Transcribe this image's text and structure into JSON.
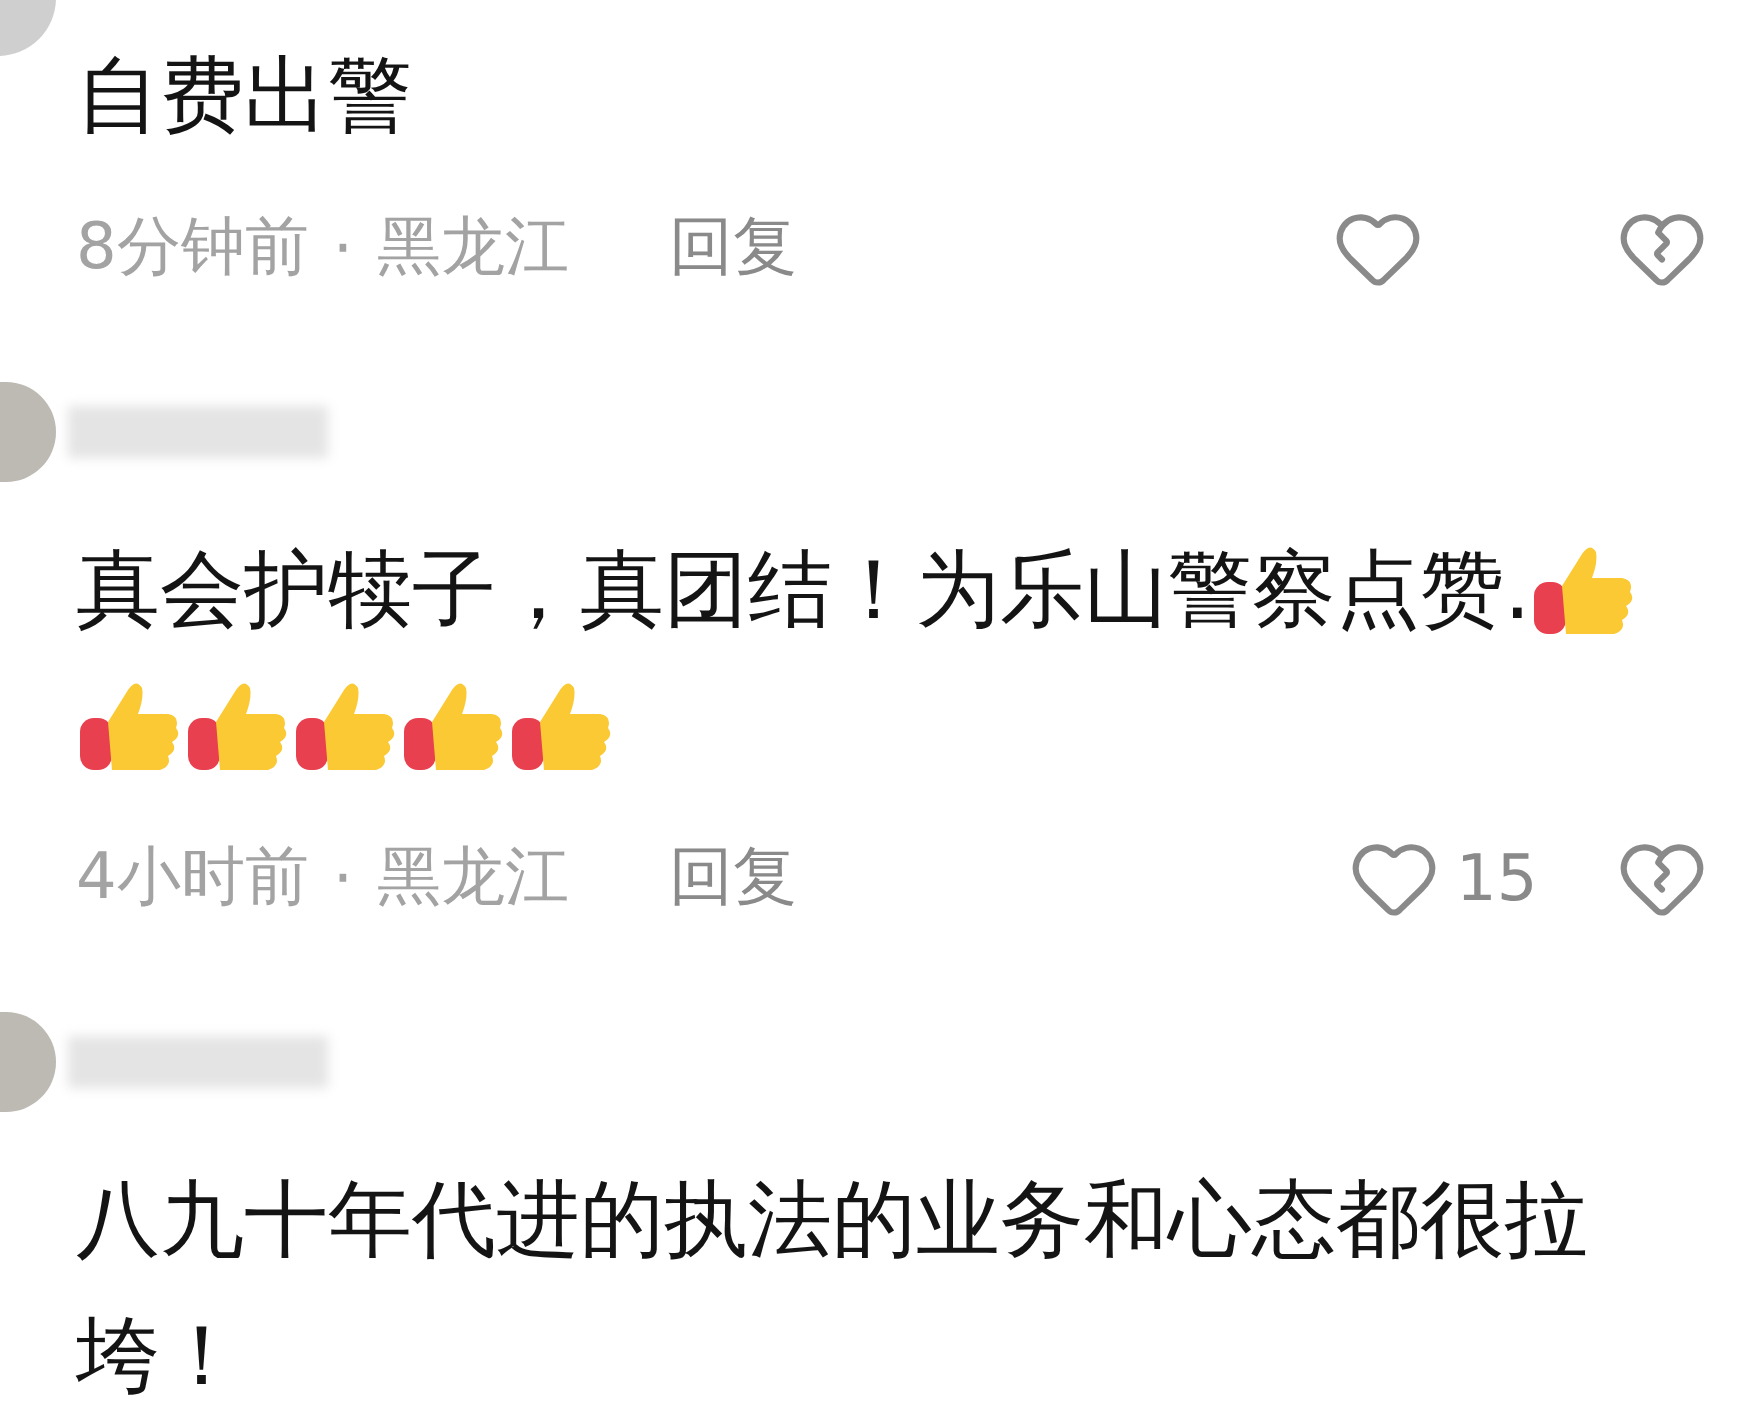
{
  "comments": [
    {
      "kind": "cut",
      "text": "自费出警",
      "meta": {
        "time": "8分钟前",
        "separator": "·",
        "location": "黑龙江",
        "reply": "回复"
      }
    },
    {
      "kind": "full",
      "text": "真会护犊子，真团结！为乐山警察点赞.",
      "reactions": [
        {
          "kind": "thumbs-up"
        },
        {
          "kind": "thumbs-up"
        },
        {
          "kind": "thumbs-up"
        },
        {
          "kind": "thumbs-up"
        },
        {
          "kind": "thumbs-up"
        },
        {
          "kind": "thumbs-up"
        }
      ],
      "meta": {
        "time": "4小时前",
        "separator": "·",
        "location": "黑龙江",
        "reply": "回复",
        "likes": "15"
      }
    },
    {
      "kind": "full",
      "text": "八九十年代进的执法的业务和心态都很拉垮！"
    }
  ]
}
